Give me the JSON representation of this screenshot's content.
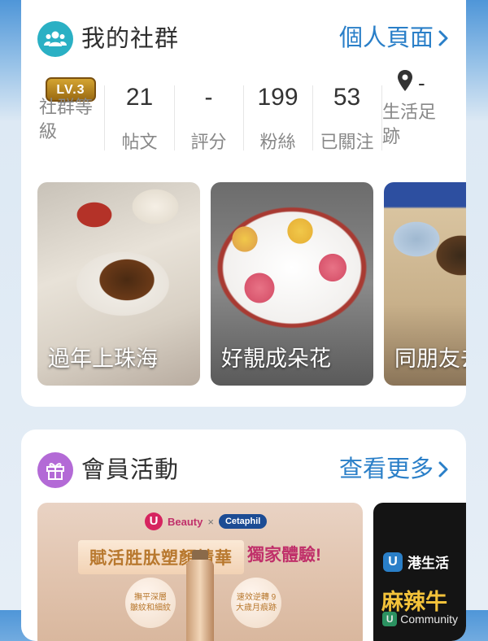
{
  "community": {
    "title": "我的社群",
    "profile_link": "個人頁面",
    "level_badge": "LV.3",
    "level_label_line1": "社群等",
    "level_label_line2": "級",
    "stats": [
      {
        "value": "21",
        "label": "帖文"
      },
      {
        "value": "-",
        "label": "評分"
      },
      {
        "value": "199",
        "label": "粉絲"
      },
      {
        "value": "53",
        "label": "已關注"
      }
    ],
    "footprint_value": "-",
    "footprint_label_line1": "生活足",
    "footprint_label_line2": "跡",
    "posts": [
      {
        "caption": "過年上珠海"
      },
      {
        "caption": "好靚成朵花"
      },
      {
        "caption": "同朋友去"
      }
    ]
  },
  "member": {
    "title": "會員活動",
    "more_link": "查看更多",
    "promo1": {
      "brand_u": "U",
      "brand_name": "Beauty",
      "cross": "×",
      "partner": "Cetaphil",
      "headline": "賦活胜肽塑顏精華",
      "tag": "獨家體驗!",
      "badge_left": "撫平深層 皺紋和細紋",
      "badge_right": "速效逆轉 9大歲月痕跡"
    },
    "promo2": {
      "brand": "港生活",
      "title": "麻辣牛",
      "watermark": "Community"
    }
  },
  "icons": {
    "community_icon": "group-people-icon",
    "member_icon": "gift-icon",
    "chevron": "chevron-right-icon",
    "location": "location-pin-icon"
  },
  "colors": {
    "accent_blue": "#2a7fc8",
    "teal": "#2ab0c4",
    "purple": "#b36ad6",
    "gold": "#c8951f"
  }
}
